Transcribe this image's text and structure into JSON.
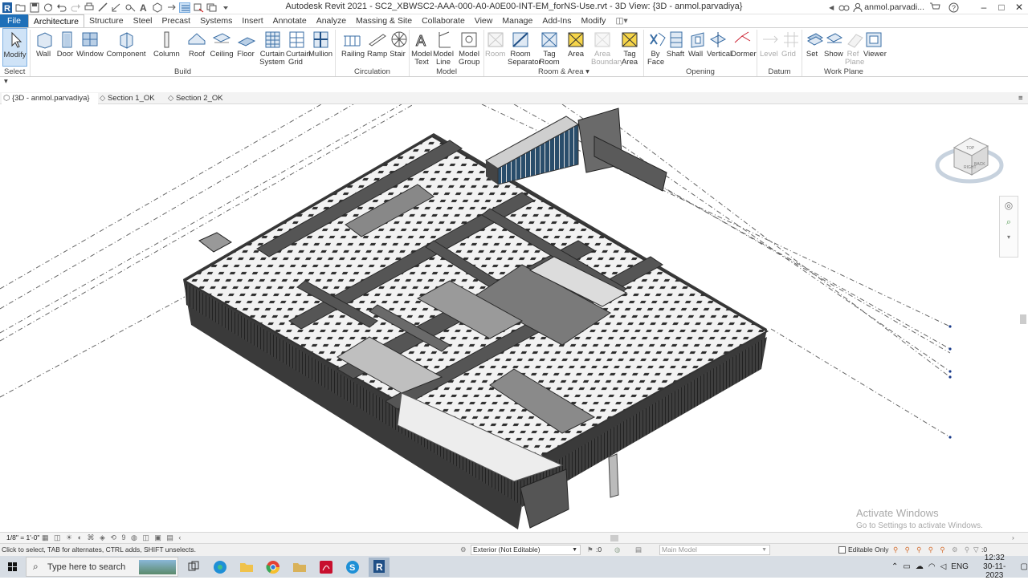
{
  "window": {
    "title": "Autodesk Revit 2021 - SC2_XBWSC2-AAA-000-A0-A0E00-INT-EM_forNS-Use.rvt - 3D View: {3D - anmol.parvadiya}",
    "user": "anmol.parvadi...",
    "minimize": "–",
    "maximize": "□",
    "close": "✕"
  },
  "menu": {
    "tabs": [
      "File",
      "Architecture",
      "Structure",
      "Steel",
      "Precast",
      "Systems",
      "Insert",
      "Annotate",
      "Analyze",
      "Massing & Site",
      "Collaborate",
      "View",
      "Manage",
      "Add-Ins",
      "Modify"
    ],
    "active": "Architecture"
  },
  "ribbon": {
    "buttons": [
      {
        "name": "Modify",
        "line2": "",
        "icon": "modify-arrow-icon",
        "enabled": true,
        "selected": true
      },
      {
        "name": "Wall",
        "line2": "",
        "icon": "wall-icon",
        "enabled": true
      },
      {
        "name": "Door",
        "line2": "",
        "icon": "door-icon",
        "enabled": true
      },
      {
        "name": "Window",
        "line2": "",
        "icon": "window-icon",
        "enabled": true
      },
      {
        "name": "Component",
        "line2": "",
        "icon": "component-icon",
        "enabled": true
      },
      {
        "name": "Column",
        "line2": "",
        "icon": "column-icon",
        "enabled": true
      },
      {
        "name": "Roof",
        "line2": "",
        "icon": "roof-icon",
        "enabled": true
      },
      {
        "name": "Ceiling",
        "line2": "",
        "icon": "ceiling-icon",
        "enabled": true
      },
      {
        "name": "Floor",
        "line2": "",
        "icon": "floor-icon",
        "enabled": true
      },
      {
        "name": "Curtain",
        "line2": "System",
        "icon": "curtain-system-icon",
        "enabled": true
      },
      {
        "name": "Curtain",
        "line2": "Grid",
        "icon": "curtain-grid-icon",
        "enabled": true
      },
      {
        "name": "Mullion",
        "line2": "",
        "icon": "mullion-icon",
        "enabled": true
      },
      {
        "name": "Railing",
        "line2": "",
        "icon": "railing-icon",
        "enabled": true
      },
      {
        "name": "Ramp",
        "line2": "",
        "icon": "ramp-icon",
        "enabled": true
      },
      {
        "name": "Stair",
        "line2": "",
        "icon": "stair-icon",
        "enabled": true
      },
      {
        "name": "Model",
        "line2": "Text",
        "icon": "model-text-icon",
        "enabled": true
      },
      {
        "name": "Model",
        "line2": "Line",
        "icon": "model-line-icon",
        "enabled": true
      },
      {
        "name": "Model",
        "line2": "Group",
        "icon": "model-group-icon",
        "enabled": true
      },
      {
        "name": "Room",
        "line2": "",
        "icon": "room-icon",
        "enabled": false
      },
      {
        "name": "Room",
        "line2": "Separator",
        "icon": "room-separator-icon",
        "enabled": true
      },
      {
        "name": "Tag",
        "line2": "Room",
        "icon": "tag-room-icon",
        "enabled": true
      },
      {
        "name": "Area",
        "line2": "",
        "icon": "area-icon",
        "enabled": true
      },
      {
        "name": "Area",
        "line2": "Boundary",
        "icon": "area-boundary-icon",
        "enabled": false
      },
      {
        "name": "Tag",
        "line2": "Area",
        "icon": "tag-area-icon",
        "enabled": true
      },
      {
        "name": "By",
        "line2": "Face",
        "icon": "by-face-icon",
        "enabled": true
      },
      {
        "name": "Shaft",
        "line2": "",
        "icon": "shaft-icon",
        "enabled": true
      },
      {
        "name": "Wall",
        "line2": "",
        "icon": "wall-opening-icon",
        "enabled": true
      },
      {
        "name": "Vertical",
        "line2": "",
        "icon": "vertical-opening-icon",
        "enabled": true
      },
      {
        "name": "Dormer",
        "line2": "",
        "icon": "dormer-icon",
        "enabled": true
      },
      {
        "name": "Level",
        "line2": "",
        "icon": "level-icon",
        "enabled": false
      },
      {
        "name": "Grid",
        "line2": "",
        "icon": "grid-icon",
        "enabled": false
      },
      {
        "name": "Set",
        "line2": "",
        "icon": "set-workplane-icon",
        "enabled": true
      },
      {
        "name": "Show",
        "line2": "",
        "icon": "show-workplane-icon",
        "enabled": true
      },
      {
        "name": "Ref",
        "line2": "Plane",
        "icon": "ref-plane-icon",
        "enabled": false
      },
      {
        "name": "Viewer",
        "line2": "",
        "icon": "viewer-icon",
        "enabled": true
      }
    ],
    "panels": [
      "Select",
      "Build",
      "Circulation",
      "Model",
      "Room & Area",
      "Opening",
      "Datum",
      "Work Plane"
    ]
  },
  "view_tabs": [
    "{3D - anmol.parvadiya}",
    "Section 1_OK",
    "Section 2_OK"
  ],
  "viewcube": {
    "right_label": "RIGHT",
    "back_label": "BACK",
    "top_label": "TOP"
  },
  "watermark": {
    "line1": "Activate Windows",
    "line2": "Go to Settings to activate Windows."
  },
  "view_control": {
    "scale": "1/8\" = 1'-0\""
  },
  "status": {
    "message": "Click to select, TAB for alternates, CTRL adds, SHIFT unselects.",
    "workset": "Exterior (Not Editable)",
    "worksharing_count": ":0",
    "design_option": "Main Model",
    "editable_only": "Editable Only",
    "filter_count": ":0"
  },
  "taskbar": {
    "search_placeholder": "Type here to search",
    "language": "ENG",
    "time": "12:32",
    "date": "30-11-2023"
  }
}
